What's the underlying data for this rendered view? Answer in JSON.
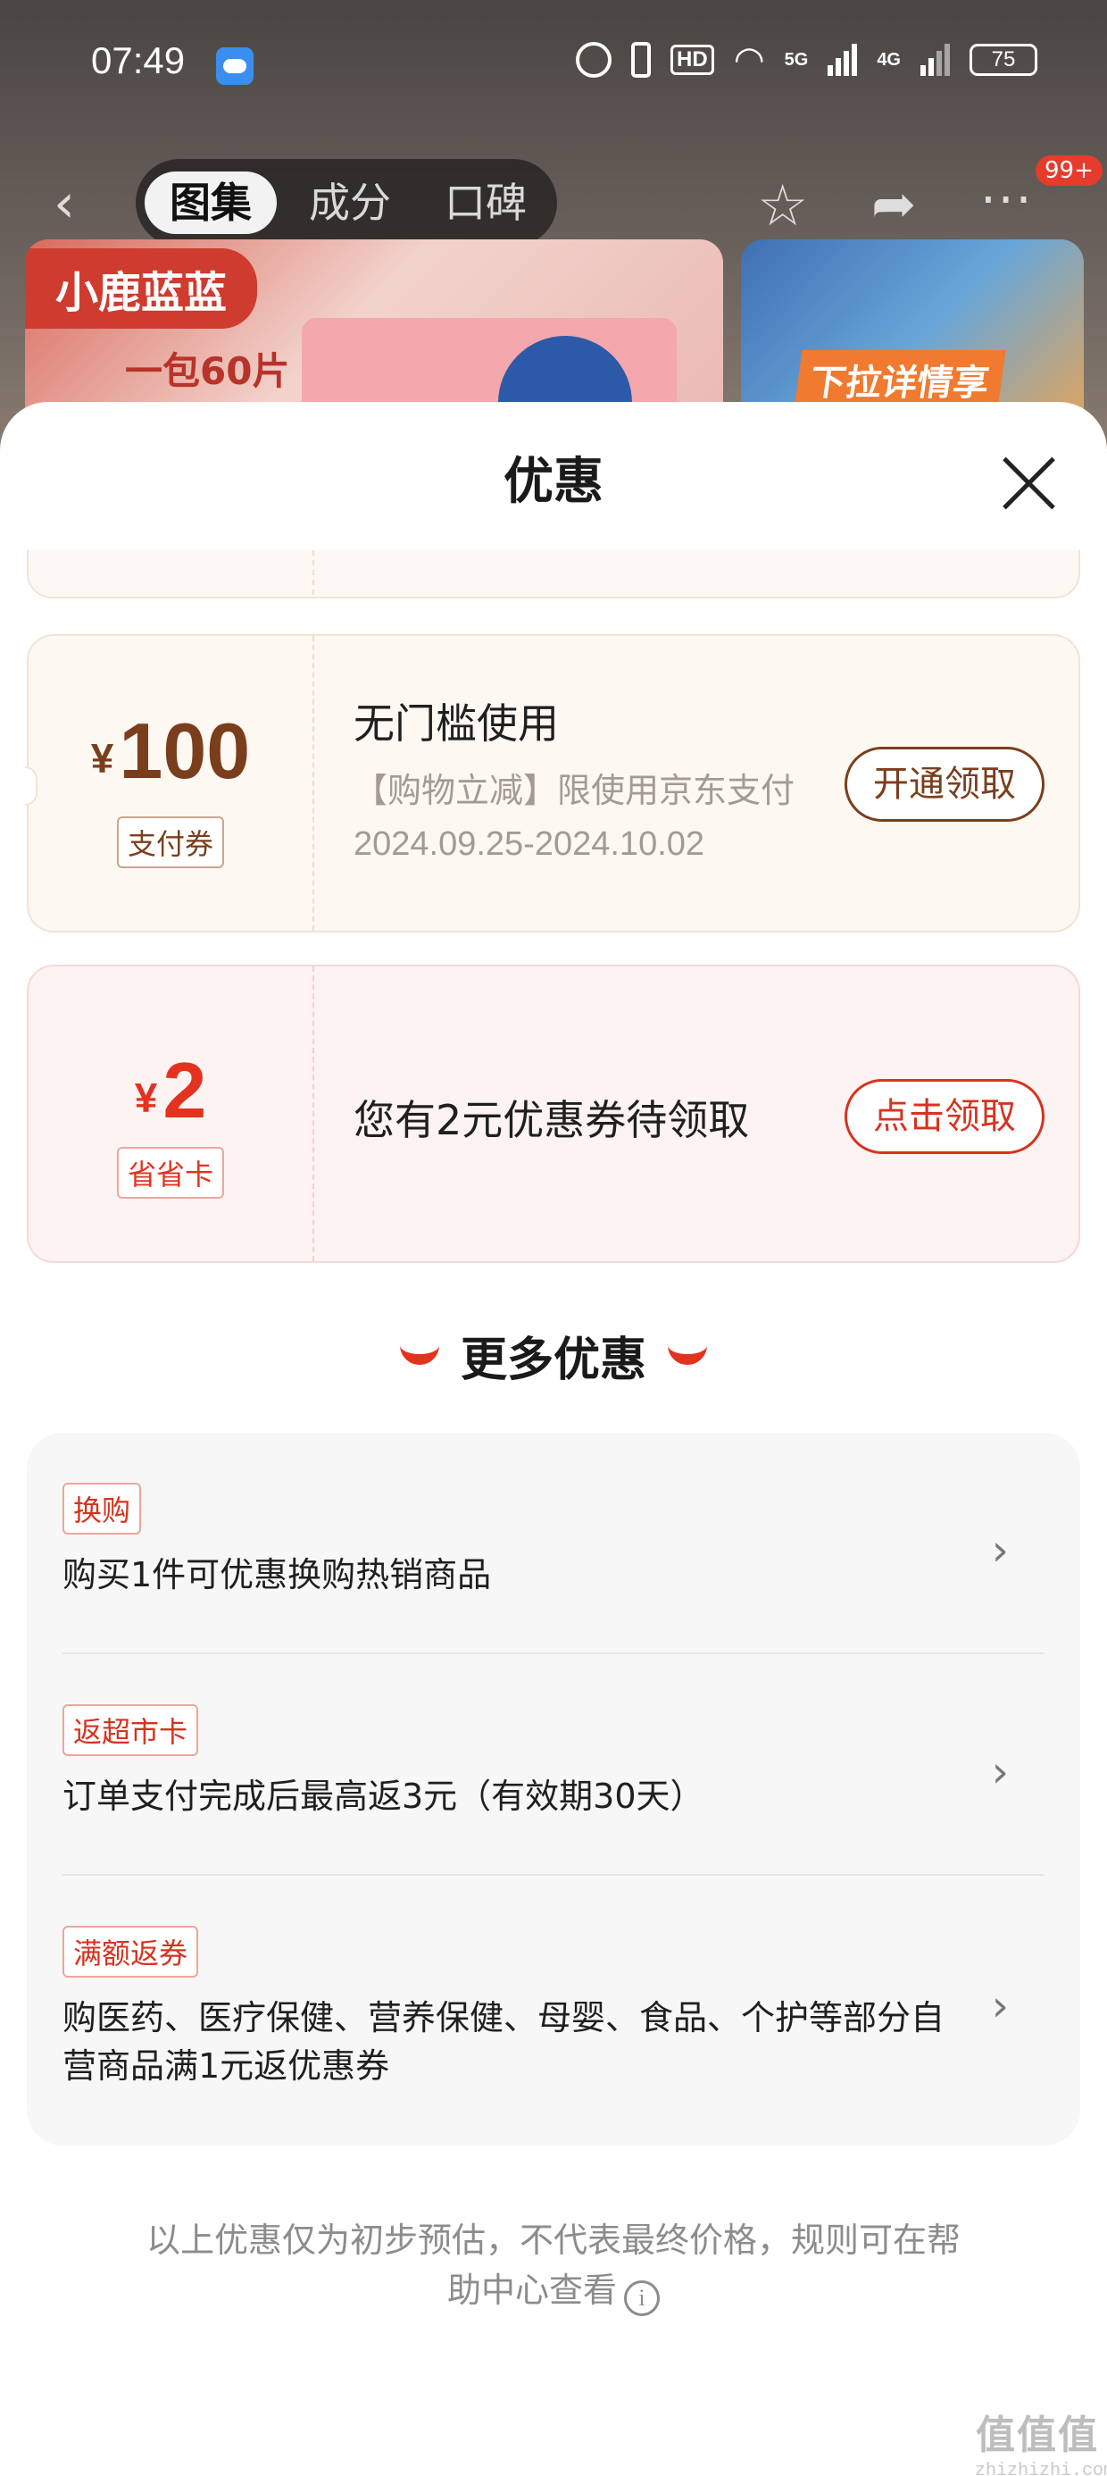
{
  "status_bar": {
    "time": "07:49",
    "hd": "HD",
    "network_1": "5G",
    "network_2": "4G",
    "battery": "75"
  },
  "nav": {
    "tabs": [
      {
        "label": "图集",
        "active": true
      },
      {
        "label": "成分",
        "active": false
      },
      {
        "label": "口碑",
        "active": false
      }
    ],
    "more_badge": "99+"
  },
  "product": {
    "brand": "小鹿蓝蓝",
    "subtitle": "一包60片",
    "side_banner": "下拉详情享"
  },
  "sheet": {
    "title": "优惠",
    "coupons": [
      {
        "currency": "¥",
        "amount": "100",
        "type": "支付券",
        "title": "无门槛使用",
        "desc": "【购物立减】限使用京东支付",
        "date": "2024.09.25-2024.10.02",
        "button": "开通领取"
      },
      {
        "currency": "¥",
        "amount": "2",
        "type": "省省卡",
        "message": "您有2元优惠券待领取",
        "button": "点击领取"
      }
    ],
    "more_title": "更多优惠",
    "offers": [
      {
        "tag": "换购",
        "text": "购买1件可优惠换购热销商品"
      },
      {
        "tag": "返超市卡",
        "text": "订单支付完成后最高返3元（有效期30天）"
      },
      {
        "tag": "满额返券",
        "text": "购医药、医疗保健、营养保健、母婴、食品、个护等部分自营商品满1元返优惠券"
      }
    ],
    "footnote": "以上优惠仅为初步预估，不代表最终价格，规则可在帮助中心查看"
  },
  "watermark": {
    "logo": "值值值",
    "site": "zhizhizhi.com"
  },
  "colors": {
    "accent_red": "#e3321f",
    "brown": "#7a3e1d"
  },
  "icons": [
    "back-icon",
    "star-icon",
    "share-icon",
    "more-icon",
    "close-icon",
    "chevron-right-icon",
    "info-icon"
  ]
}
